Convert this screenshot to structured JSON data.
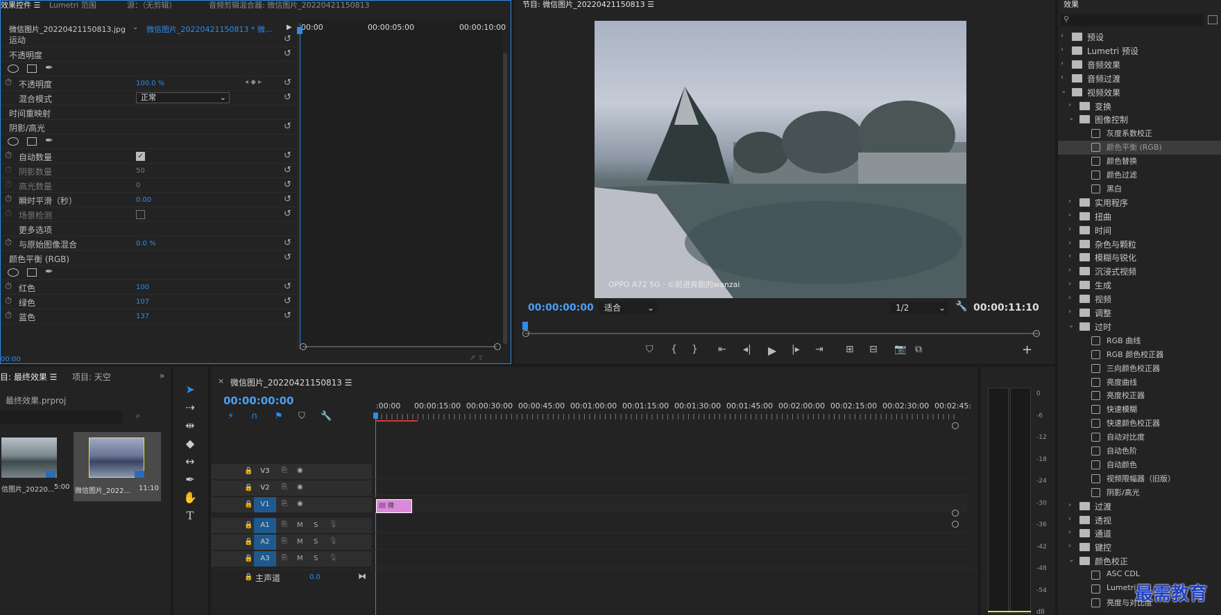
{
  "effect_controls": {
    "tabs": [
      "效果控件",
      "Lumetri 范围",
      "源：（无剪辑）",
      "音频剪辑混合器: 微信图片_20220421150813"
    ],
    "source_clip": "微信图片_20220421150813.jpg",
    "seq_clip": "微信图片_20220421150813 * 微...",
    "ruler": [
      "00:00",
      "00:00:05:00",
      "00:00:10:00"
    ],
    "rows": {
      "motion": "运动",
      "opacity_group": "不透明度",
      "opacity": "不透明度",
      "opacity_val": "100.0 %",
      "blend": "混合模式",
      "blend_val": "正常",
      "time_remap": "时间重映射",
      "shadow_group": "阴影/高光",
      "auto_amount": "自动数量",
      "shadow_amount": "阴影数量",
      "shadow_val": "50",
      "highlight_amount": "高光数量",
      "highlight_val": "0",
      "temporal": "瞬时平滑（秒）",
      "temporal_val": "0.00",
      "scene_detect": "场景检测",
      "more": "更多选项",
      "blend_orig": "与原始图像混合",
      "blend_orig_val": "0.0 %",
      "color_balance": "颜色平衡 (RGB)",
      "red": "红色",
      "red_val": "100",
      "green": "绿色",
      "green_val": "107",
      "blue": "蓝色",
      "blue_val": "137"
    },
    "timecode": "00:00"
  },
  "program": {
    "title": "节目: 微信图片_20220421150813",
    "timecode": "00:00:00:00",
    "fit": "适合",
    "res": "1/2",
    "duration": "00:00:11:10",
    "watermark": "OPPO A72 5G · ©前进奔跑的wanzai"
  },
  "effects": {
    "title": "效果",
    "items": [
      {
        "label": "预设",
        "lvl": 0,
        "kind": "folder",
        "open": false
      },
      {
        "label": "Lumetri 预设",
        "lvl": 0,
        "kind": "folder",
        "open": false
      },
      {
        "label": "音频效果",
        "lvl": 0,
        "kind": "folder",
        "open": false
      },
      {
        "label": "音频过渡",
        "lvl": 0,
        "kind": "folder",
        "open": false
      },
      {
        "label": "视频效果",
        "lvl": 0,
        "kind": "folder",
        "open": true
      },
      {
        "label": "变换",
        "lvl": 1,
        "kind": "folder",
        "open": false
      },
      {
        "label": "图像控制",
        "lvl": 1,
        "kind": "folder",
        "open": true
      },
      {
        "label": "灰度系数校正",
        "lvl": 2,
        "kind": "fx"
      },
      {
        "label": "颜色平衡 (RGB)",
        "lvl": 2,
        "kind": "fx",
        "sel": true
      },
      {
        "label": "颜色替换",
        "lvl": 2,
        "kind": "fx"
      },
      {
        "label": "颜色过滤",
        "lvl": 2,
        "kind": "fx"
      },
      {
        "label": "黑白",
        "lvl": 2,
        "kind": "fx"
      },
      {
        "label": "实用程序",
        "lvl": 1,
        "kind": "folder",
        "open": false
      },
      {
        "label": "扭曲",
        "lvl": 1,
        "kind": "folder",
        "open": false
      },
      {
        "label": "时间",
        "lvl": 1,
        "kind": "folder",
        "open": false
      },
      {
        "label": "杂色与颗粒",
        "lvl": 1,
        "kind": "folder",
        "open": false
      },
      {
        "label": "模糊与锐化",
        "lvl": 1,
        "kind": "folder",
        "open": false
      },
      {
        "label": "沉浸式视频",
        "lvl": 1,
        "kind": "folder",
        "open": false
      },
      {
        "label": "生成",
        "lvl": 1,
        "kind": "folder",
        "open": false
      },
      {
        "label": "视频",
        "lvl": 1,
        "kind": "folder",
        "open": false
      },
      {
        "label": "调整",
        "lvl": 1,
        "kind": "folder",
        "open": false
      },
      {
        "label": "过时",
        "lvl": 1,
        "kind": "folder",
        "open": true
      },
      {
        "label": "RGB 曲线",
        "lvl": 2,
        "kind": "fx"
      },
      {
        "label": "RGB 颜色校正器",
        "lvl": 2,
        "kind": "fx"
      },
      {
        "label": "三向颜色校正器",
        "lvl": 2,
        "kind": "fx"
      },
      {
        "label": "亮度曲线",
        "lvl": 2,
        "kind": "fx"
      },
      {
        "label": "亮度校正器",
        "lvl": 2,
        "kind": "fx"
      },
      {
        "label": "快速模糊",
        "lvl": 2,
        "kind": "fx"
      },
      {
        "label": "快速颜色校正器",
        "lvl": 2,
        "kind": "fx"
      },
      {
        "label": "自动对比度",
        "lvl": 2,
        "kind": "fx"
      },
      {
        "label": "自动色阶",
        "lvl": 2,
        "kind": "fx"
      },
      {
        "label": "自动颜色",
        "lvl": 2,
        "kind": "fx"
      },
      {
        "label": "视频限幅器（旧版）",
        "lvl": 2,
        "kind": "fx"
      },
      {
        "label": "阴影/高光",
        "lvl": 2,
        "kind": "fx"
      },
      {
        "label": "过渡",
        "lvl": 1,
        "kind": "folder",
        "open": false
      },
      {
        "label": "透视",
        "lvl": 1,
        "kind": "folder",
        "open": false
      },
      {
        "label": "通道",
        "lvl": 1,
        "kind": "folder",
        "open": false
      },
      {
        "label": "键控",
        "lvl": 1,
        "kind": "folder",
        "open": false
      },
      {
        "label": "颜色校正",
        "lvl": 1,
        "kind": "folder",
        "open": true
      },
      {
        "label": "ASC CDL",
        "lvl": 2,
        "kind": "fx"
      },
      {
        "label": "Lumetri",
        "lvl": 2,
        "kind": "fx"
      },
      {
        "label": "亮度与对比度",
        "lvl": 2,
        "kind": "fx"
      }
    ]
  },
  "project": {
    "tab1": "目: 最终效果",
    "tab2": "项目: 天空",
    "file": "最终效果.prproj",
    "thumbs": [
      {
        "name": "信图片_20220...",
        "dur": "5:00"
      },
      {
        "name": "微信图片_2022...",
        "dur": "11:10"
      }
    ]
  },
  "timeline": {
    "title": "微信图片_20220421150813",
    "timecode": "00:00:00:00",
    "ruler": [
      ":00:00",
      "00:00:15:00",
      "00:00:30:00",
      "00:00:45:00",
      "00:01:00:00",
      "00:01:15:00",
      "00:01:30:00",
      "00:01:45:00",
      "00:02:00:00",
      "00:02:15:00",
      "00:02:30:00",
      "00:02:45:"
    ],
    "tracks": [
      {
        "id": "V3",
        "type": "video",
        "target": false
      },
      {
        "id": "V2",
        "type": "video",
        "target": false
      },
      {
        "id": "V1",
        "type": "video",
        "target": true
      },
      {
        "id": "A1",
        "type": "audio",
        "target": true
      },
      {
        "id": "A2",
        "type": "audio",
        "target": true
      },
      {
        "id": "A3",
        "type": "audio",
        "target": true
      }
    ],
    "m": "M",
    "s": "S",
    "master": "主声道",
    "master_val": "0.0",
    "clip_label": "微"
  },
  "meter": {
    "ticks": [
      "0",
      "-6",
      "-12",
      "-18",
      "-24",
      "-30",
      "-36",
      "-42",
      "-48",
      "-54",
      "dB"
    ]
  },
  "brand": "最需教育",
  "colors": {
    "accent": "#2d8ceb",
    "clip": "#d98ad9",
    "panel": "#232323"
  }
}
